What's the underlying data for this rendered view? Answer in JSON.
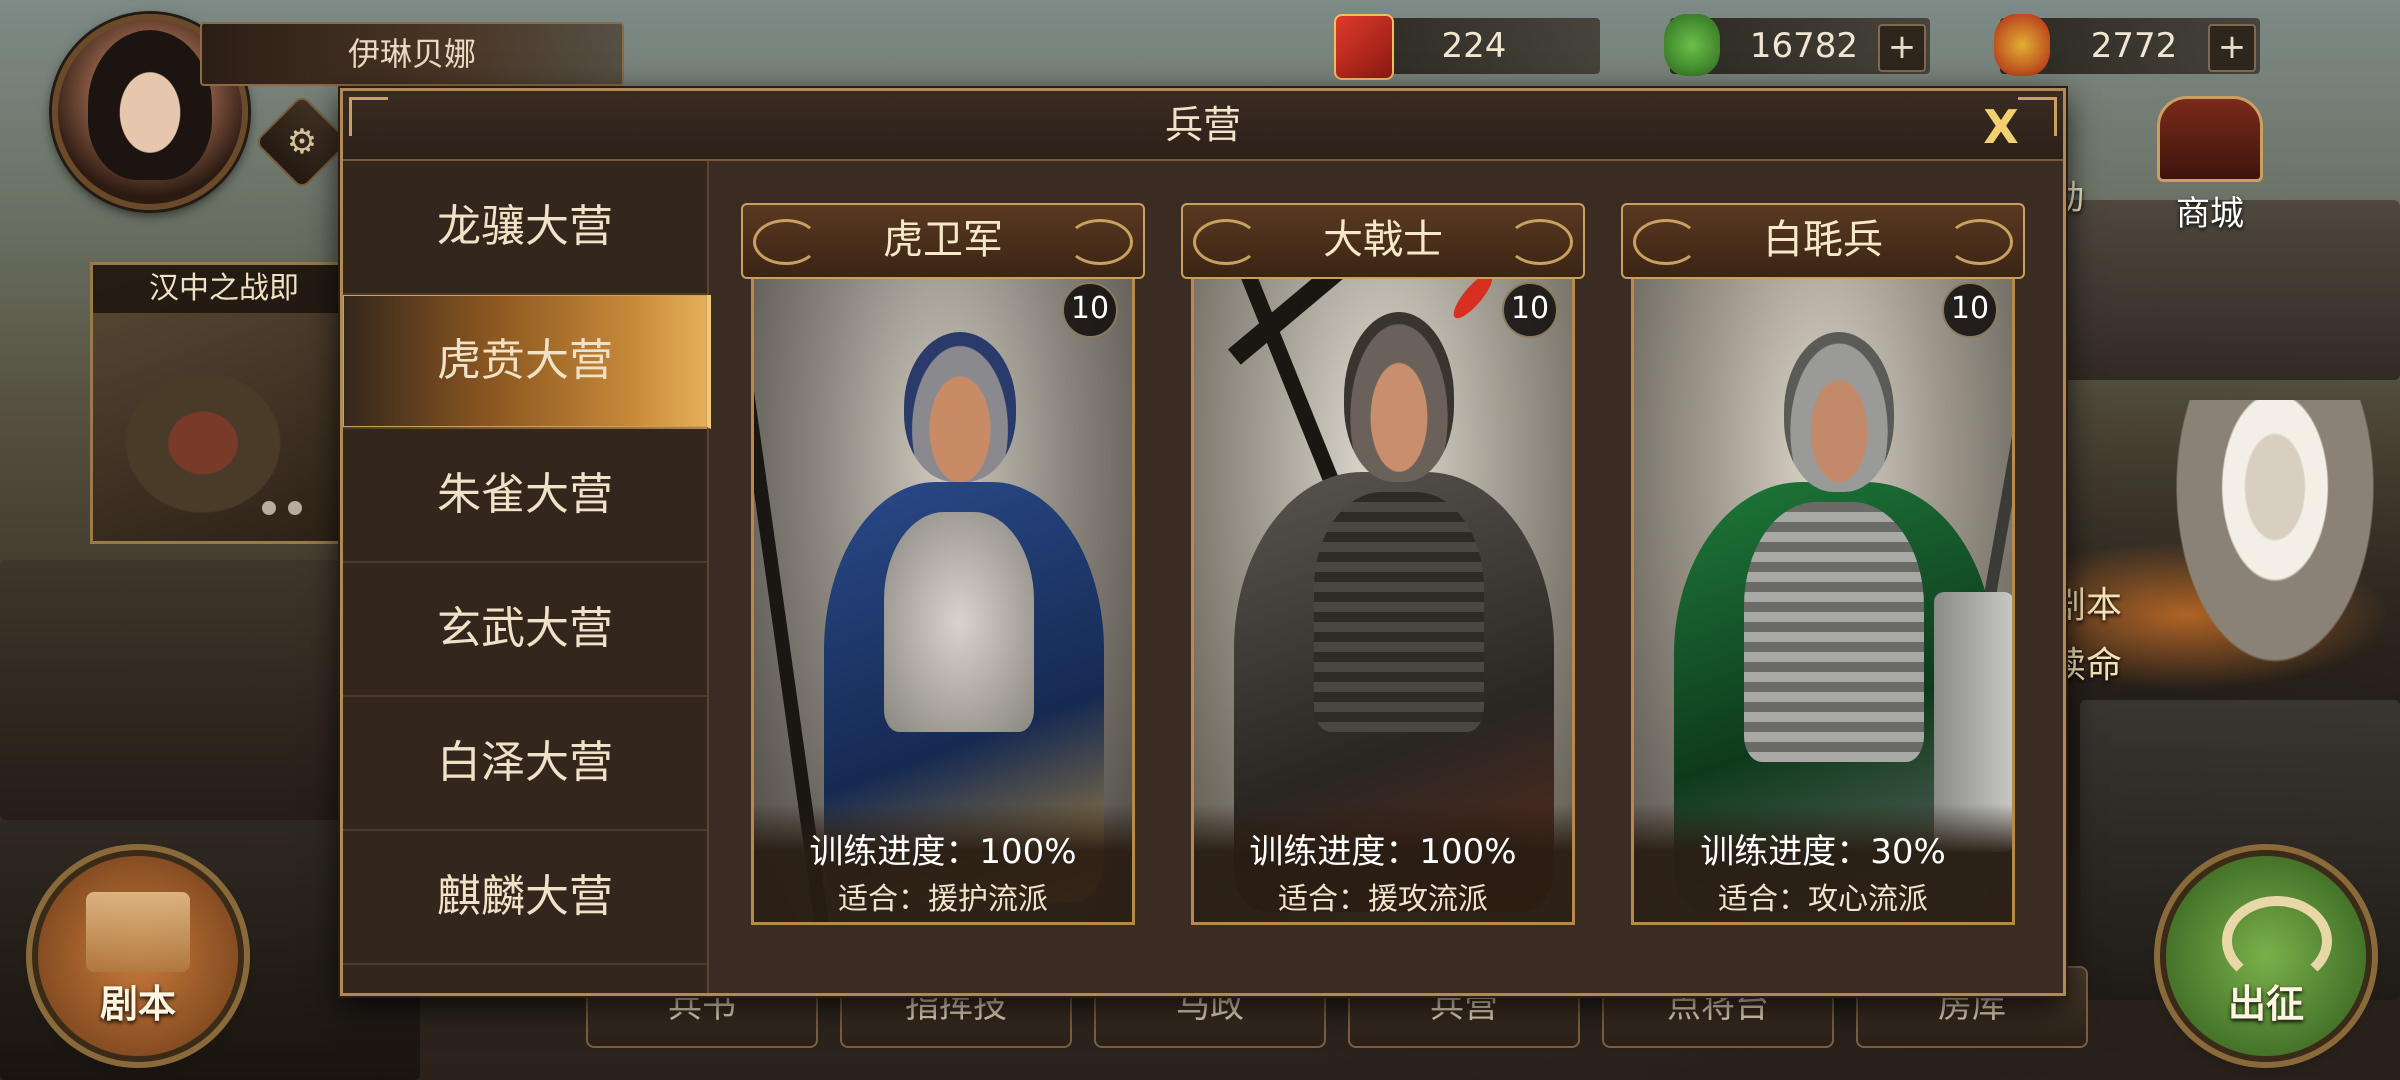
{
  "player": {
    "name": "伊琳贝娜"
  },
  "currencies": [
    {
      "icon": "red-token-icon",
      "value": "224"
    },
    {
      "icon": "jade-icon",
      "value": "16782"
    },
    {
      "icon": "gold-jade-icon",
      "value": "2772"
    }
  ],
  "plus_label": "+",
  "left_banner": {
    "title": "汉中之战即"
  },
  "right": {
    "activity_label": "动",
    "shop_label": "商城",
    "event_line1": "剧本",
    "event_line2": "续命"
  },
  "bottom_left_button": "剧本",
  "bottom_right_button": "出征",
  "bottom_nav": [
    "兵书",
    "指挥技",
    "马政",
    "兵营",
    "点将台",
    "房库"
  ],
  "barracks": {
    "title": "兵营",
    "close_label": "X",
    "sidebar": [
      "龙骧大营",
      "虎贲大营",
      "朱雀大营",
      "玄武大营",
      "白泽大营",
      "麒麟大营"
    ],
    "active_index": 1,
    "cards": [
      {
        "name": "虎卫军",
        "level": "10",
        "progress": "训练进度：100%",
        "suit": "适合：援护流派",
        "accent": "#2a4a8a"
      },
      {
        "name": "大戟士",
        "level": "10",
        "progress": "训练进度：100%",
        "suit": "适合：援攻流派",
        "accent": "#5a5550"
      },
      {
        "name": "白毦兵",
        "level": "10",
        "progress": "训练进度：30%",
        "suit": "适合：攻心流派",
        "accent": "#1e7a3a"
      }
    ]
  }
}
